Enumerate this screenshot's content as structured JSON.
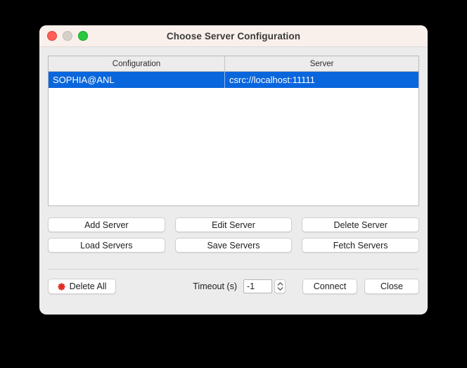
{
  "window": {
    "title": "Choose Server Configuration",
    "traffic_lights": [
      {
        "name": "close",
        "color": "#ff5f57"
      },
      {
        "name": "minimize",
        "color": "#d6d0cb"
      },
      {
        "name": "zoom",
        "color": "#28c840"
      }
    ],
    "accent_color": "#0a66dc",
    "titlebar_color": "#f9f0ec",
    "background_color": "#ececec"
  },
  "table": {
    "columns": [
      "Configuration",
      "Server"
    ],
    "rows": [
      {
        "configuration": "SOPHIA@ANL",
        "server": "csrc://localhost:11111",
        "selected": true
      }
    ]
  },
  "actions": {
    "add_server": "Add Server",
    "edit_server": "Edit Server",
    "delete_server": "Delete Server",
    "load_servers": "Load Servers",
    "save_servers": "Save Servers",
    "fetch_servers": "Fetch Servers"
  },
  "footer": {
    "delete_all": "Delete All",
    "delete_all_icon": "asterisk-icon",
    "delete_all_icon_color": "#e02b20",
    "timeout_label": "Timeout (s)",
    "timeout_value": "-1",
    "connect": "Connect",
    "close": "Close"
  }
}
